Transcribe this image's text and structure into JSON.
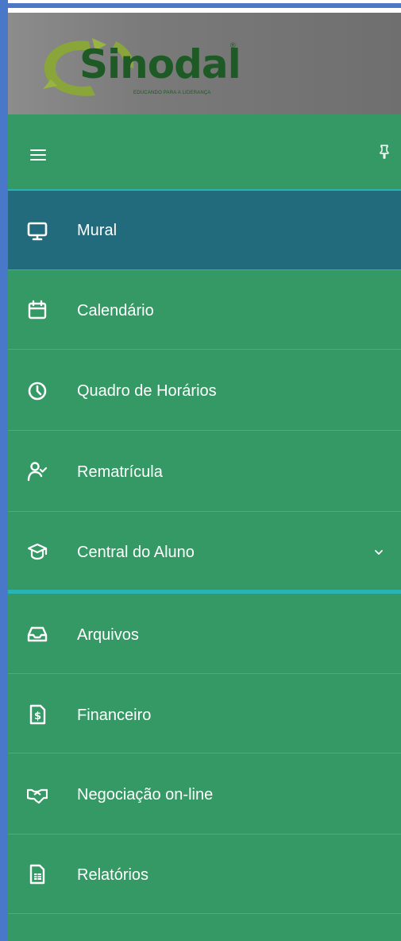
{
  "brand": {
    "name": "Sinodal",
    "registered": "®",
    "tagline": "EDUCANDO PARA A LIDERANÇA"
  },
  "colors": {
    "menu_bg": "#359965",
    "active_bg": "#226b7c",
    "divider": "#2ab3b3",
    "text": "#ffffff",
    "frame": "#4a78c8"
  },
  "header": {
    "menu_icon": "hamburger-icon",
    "pin_icon": "pin-icon"
  },
  "menu": {
    "items": [
      {
        "label": "Mural",
        "icon": "monitor-icon",
        "active": true
      },
      {
        "label": "Calendário",
        "icon": "calendar-icon",
        "active": false
      },
      {
        "label": "Quadro de Horários",
        "icon": "clock-icon",
        "active": false
      },
      {
        "label": "Rematrícula",
        "icon": "user-check-icon",
        "active": false
      },
      {
        "label": "Central do Aluno",
        "icon": "graduation-cap-icon",
        "active": false,
        "expandable": true
      },
      {
        "label": "Arquivos",
        "icon": "inbox-icon",
        "active": false
      },
      {
        "label": "Financeiro",
        "icon": "dollar-document-icon",
        "active": false
      },
      {
        "label": "Negociação on-line",
        "icon": "handshake-icon",
        "active": false
      },
      {
        "label": "Relatórios",
        "icon": "report-icon",
        "active": false
      }
    ]
  }
}
